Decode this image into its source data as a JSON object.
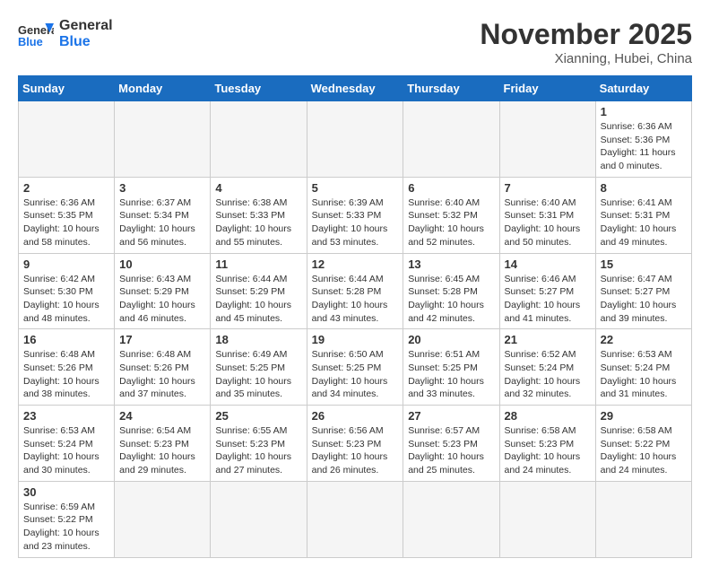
{
  "header": {
    "logo_general": "General",
    "logo_blue": "Blue",
    "month_title": "November 2025",
    "location": "Xianning, Hubei, China"
  },
  "days_of_week": [
    "Sunday",
    "Monday",
    "Tuesday",
    "Wednesday",
    "Thursday",
    "Friday",
    "Saturday"
  ],
  "weeks": [
    [
      {
        "day": "",
        "info": ""
      },
      {
        "day": "",
        "info": ""
      },
      {
        "day": "",
        "info": ""
      },
      {
        "day": "",
        "info": ""
      },
      {
        "day": "",
        "info": ""
      },
      {
        "day": "",
        "info": ""
      },
      {
        "day": "1",
        "info": "Sunrise: 6:36 AM\nSunset: 5:36 PM\nDaylight: 11 hours and 0 minutes."
      }
    ],
    [
      {
        "day": "2",
        "info": "Sunrise: 6:36 AM\nSunset: 5:35 PM\nDaylight: 10 hours and 58 minutes."
      },
      {
        "day": "3",
        "info": "Sunrise: 6:37 AM\nSunset: 5:34 PM\nDaylight: 10 hours and 56 minutes."
      },
      {
        "day": "4",
        "info": "Sunrise: 6:38 AM\nSunset: 5:33 PM\nDaylight: 10 hours and 55 minutes."
      },
      {
        "day": "5",
        "info": "Sunrise: 6:39 AM\nSunset: 5:33 PM\nDaylight: 10 hours and 53 minutes."
      },
      {
        "day": "6",
        "info": "Sunrise: 6:40 AM\nSunset: 5:32 PM\nDaylight: 10 hours and 52 minutes."
      },
      {
        "day": "7",
        "info": "Sunrise: 6:40 AM\nSunset: 5:31 PM\nDaylight: 10 hours and 50 minutes."
      },
      {
        "day": "8",
        "info": "Sunrise: 6:41 AM\nSunset: 5:31 PM\nDaylight: 10 hours and 49 minutes."
      }
    ],
    [
      {
        "day": "9",
        "info": "Sunrise: 6:42 AM\nSunset: 5:30 PM\nDaylight: 10 hours and 48 minutes."
      },
      {
        "day": "10",
        "info": "Sunrise: 6:43 AM\nSunset: 5:29 PM\nDaylight: 10 hours and 46 minutes."
      },
      {
        "day": "11",
        "info": "Sunrise: 6:44 AM\nSunset: 5:29 PM\nDaylight: 10 hours and 45 minutes."
      },
      {
        "day": "12",
        "info": "Sunrise: 6:44 AM\nSunset: 5:28 PM\nDaylight: 10 hours and 43 minutes."
      },
      {
        "day": "13",
        "info": "Sunrise: 6:45 AM\nSunset: 5:28 PM\nDaylight: 10 hours and 42 minutes."
      },
      {
        "day": "14",
        "info": "Sunrise: 6:46 AM\nSunset: 5:27 PM\nDaylight: 10 hours and 41 minutes."
      },
      {
        "day": "15",
        "info": "Sunrise: 6:47 AM\nSunset: 5:27 PM\nDaylight: 10 hours and 39 minutes."
      }
    ],
    [
      {
        "day": "16",
        "info": "Sunrise: 6:48 AM\nSunset: 5:26 PM\nDaylight: 10 hours and 38 minutes."
      },
      {
        "day": "17",
        "info": "Sunrise: 6:48 AM\nSunset: 5:26 PM\nDaylight: 10 hours and 37 minutes."
      },
      {
        "day": "18",
        "info": "Sunrise: 6:49 AM\nSunset: 5:25 PM\nDaylight: 10 hours and 35 minutes."
      },
      {
        "day": "19",
        "info": "Sunrise: 6:50 AM\nSunset: 5:25 PM\nDaylight: 10 hours and 34 minutes."
      },
      {
        "day": "20",
        "info": "Sunrise: 6:51 AM\nSunset: 5:25 PM\nDaylight: 10 hours and 33 minutes."
      },
      {
        "day": "21",
        "info": "Sunrise: 6:52 AM\nSunset: 5:24 PM\nDaylight: 10 hours and 32 minutes."
      },
      {
        "day": "22",
        "info": "Sunrise: 6:53 AM\nSunset: 5:24 PM\nDaylight: 10 hours and 31 minutes."
      }
    ],
    [
      {
        "day": "23",
        "info": "Sunrise: 6:53 AM\nSunset: 5:24 PM\nDaylight: 10 hours and 30 minutes."
      },
      {
        "day": "24",
        "info": "Sunrise: 6:54 AM\nSunset: 5:23 PM\nDaylight: 10 hours and 29 minutes."
      },
      {
        "day": "25",
        "info": "Sunrise: 6:55 AM\nSunset: 5:23 PM\nDaylight: 10 hours and 27 minutes."
      },
      {
        "day": "26",
        "info": "Sunrise: 6:56 AM\nSunset: 5:23 PM\nDaylight: 10 hours and 26 minutes."
      },
      {
        "day": "27",
        "info": "Sunrise: 6:57 AM\nSunset: 5:23 PM\nDaylight: 10 hours and 25 minutes."
      },
      {
        "day": "28",
        "info": "Sunrise: 6:58 AM\nSunset: 5:23 PM\nDaylight: 10 hours and 24 minutes."
      },
      {
        "day": "29",
        "info": "Sunrise: 6:58 AM\nSunset: 5:22 PM\nDaylight: 10 hours and 24 minutes."
      }
    ],
    [
      {
        "day": "30",
        "info": "Sunrise: 6:59 AM\nSunset: 5:22 PM\nDaylight: 10 hours and 23 minutes."
      },
      {
        "day": "",
        "info": ""
      },
      {
        "day": "",
        "info": ""
      },
      {
        "day": "",
        "info": ""
      },
      {
        "day": "",
        "info": ""
      },
      {
        "day": "",
        "info": ""
      },
      {
        "day": "",
        "info": ""
      }
    ]
  ]
}
